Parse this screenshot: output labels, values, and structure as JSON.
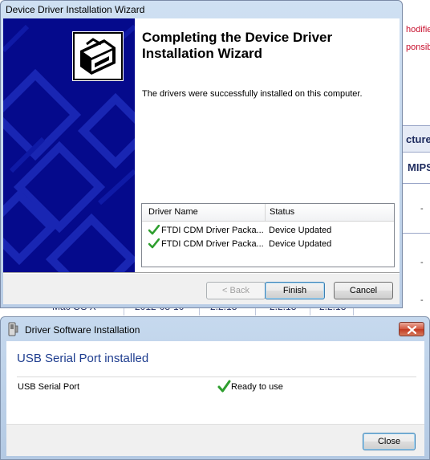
{
  "background_page": {
    "fragments": [
      "hodifie",
      "ponsib",
      "cture",
      "MIPS"
    ],
    "row": {
      "cells": [
        "Mac OS X",
        "2012-08-10",
        "2.2.18",
        "2.2.18",
        "2.2.18",
        "-"
      ]
    },
    "dash": "-"
  },
  "wizard": {
    "title": "Device Driver Installation Wizard",
    "heading": "Completing the Device Driver Installation Wizard",
    "message": "The drivers were successfully installed on this computer.",
    "table": {
      "columns": [
        "Driver Name",
        "Status"
      ],
      "rows": [
        {
          "name": "FTDI CDM Driver Packa...",
          "status": "Device Updated"
        },
        {
          "name": "FTDI CDM Driver Packa...",
          "status": "Device Updated"
        }
      ]
    },
    "buttons": {
      "back": "< Back",
      "finish": "Finish",
      "cancel": "Cancel"
    }
  },
  "dialog": {
    "title": "Driver Software Installation",
    "heading": "USB Serial Port installed",
    "device": "USB Serial Port",
    "status": "Ready to use",
    "close_label": "Close"
  },
  "icons": {
    "check": "checkmark-icon",
    "wizard_image": "hardware-install-icon",
    "dialog_icon": "driver-install-icon",
    "close": "close-x-icon"
  },
  "colors": {
    "banner": "#050a8c",
    "check_green": "#2e9e2e",
    "dialog_heading": "#1e3d8f",
    "bg_red": "#c8102e",
    "bg_heading": "#1e2b5e"
  }
}
